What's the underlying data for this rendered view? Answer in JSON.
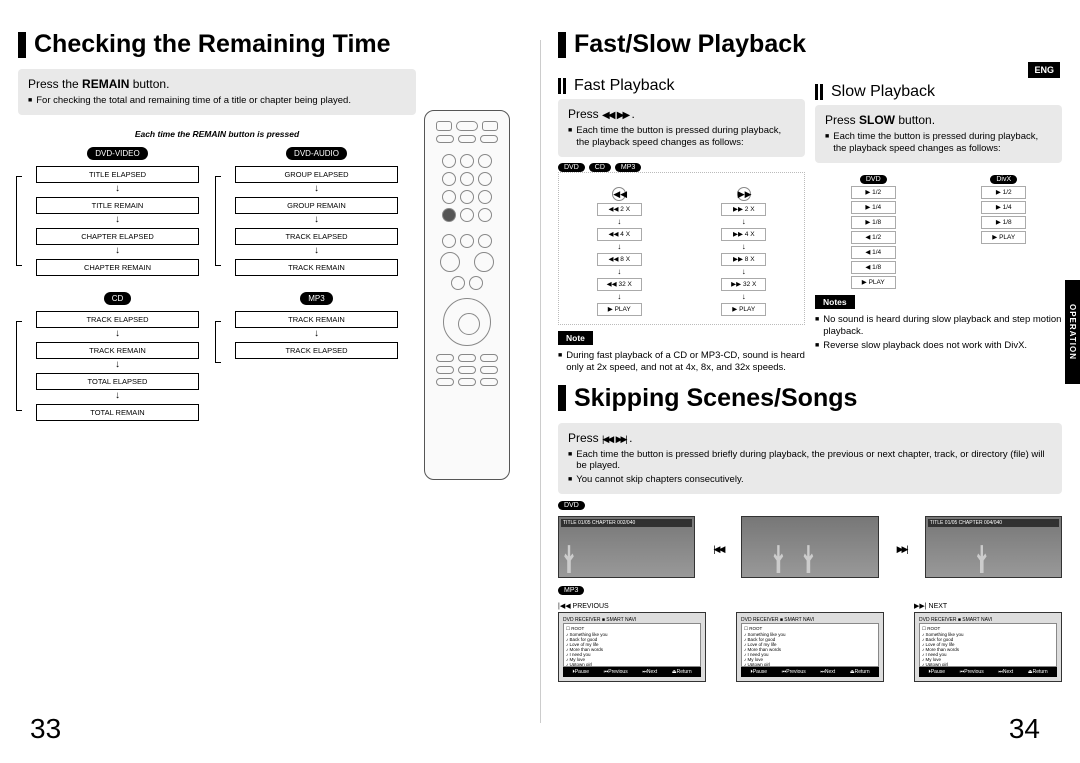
{
  "lang_badge": "ENG",
  "side_tab": "OPERATION",
  "page_left_num": "33",
  "page_right_num": "34",
  "left": {
    "title": "Checking the Remaining Time",
    "instr_title_pre": "Press the ",
    "instr_title_bold": "REMAIN",
    "instr_title_post": " button.",
    "instr_bullet": "For checking the total and remaining time of a title or chapter being played.",
    "sub_caption": "Each time the REMAIN button is pressed",
    "cycles": [
      {
        "pill": "DVD-VIDEO",
        "steps": [
          "TITLE ELAPSED",
          "TITLE REMAIN",
          "CHAPTER ELAPSED",
          "CHAPTER REMAIN"
        ]
      },
      {
        "pill": "DVD-AUDIO",
        "steps": [
          "GROUP ELAPSED",
          "GROUP REMAIN",
          "TRACK ELAPSED",
          "TRACK REMAIN"
        ]
      },
      {
        "pill": "CD",
        "steps": [
          "TRACK ELAPSED",
          "TRACK REMAIN",
          "TOTAL ELAPSED",
          "TOTAL REMAIN"
        ]
      },
      {
        "pill": "MP3",
        "steps": [
          "TRACK REMAIN",
          "TRACK ELAPSED"
        ]
      }
    ]
  },
  "right": {
    "title1": "Fast/Slow Playback",
    "fast": {
      "subtitle": "Fast Playback",
      "instr": "Press",
      "bullet": "Each time the button is pressed during playback, the playback speed changes as follows:",
      "pills": [
        "DVD",
        "CD",
        "MP3"
      ],
      "rew": [
        "◀◀ 2 X",
        "◀◀ 4 X",
        "◀◀ 8 X",
        "◀◀ 32 X",
        "▶ PLAY"
      ],
      "ff": [
        "▶▶ 2 X",
        "▶▶ 4 X",
        "▶▶ 8 X",
        "▶▶ 32 X",
        "▶ PLAY"
      ],
      "note_label": "Note",
      "note": "During fast playback of a CD or MP3-CD, sound is heard only at 2x speed, and not at 4x, 8x, and 32x speeds."
    },
    "slow": {
      "subtitle": "Slow Playback",
      "instr_pre": "Press ",
      "instr_bold": "SLOW",
      "instr_post": " button.",
      "bullet": "Each time the button is pressed during playback, the playback speed changes as follows:",
      "dvd_pill": "DVD",
      "divx_pill": "DivX",
      "dvd_steps": [
        "▶ 1/2",
        "▶ 1/4",
        "▶ 1/8",
        "◀ 1/2",
        "◀ 1/4",
        "◀ 1/8",
        "▶ PLAY"
      ],
      "divx_steps": [
        "▶ 1/2",
        "▶ 1/4",
        "▶ 1/8",
        "▶ PLAY"
      ],
      "notes_label": "Notes",
      "note1": "No sound is heard during slow playback and step motion playback.",
      "note2": "Reverse slow playback does not work with DivX."
    },
    "title2": "Skipping Scenes/Songs",
    "skip": {
      "instr": "Press",
      "bullet1": "Each time the button is pressed briefly during playback, the previous or next chapter, track, or directory (file) will be played.",
      "bullet2": "You cannot skip chapters consecutively.",
      "dvd_pill": "DVD",
      "mp3_pill": "MP3",
      "dvd_overlay_a": "TITLE  01/05  CHAPTER  002/040",
      "dvd_overlay_b": "TITLE  01/05  CHAPTER  004/040",
      "mp3_prev": "|◀◀ PREVIOUS",
      "mp3_next": "▶▶| NEXT",
      "mp3_header": "DVD RECEIVER                    ■ SMART NAVI",
      "mp3_root": "☐ ROOT",
      "mp3_items": [
        "♪ Something like you",
        "♪ Back for good",
        "♪ Love of my life",
        "♪ More than words",
        "♪ I need you",
        "♪ My love",
        "♪ Uptown girl"
      ],
      "mp3_footer": [
        "⏵Pause",
        "⏮Previous",
        "⏭Next",
        "⏏Return"
      ]
    }
  }
}
